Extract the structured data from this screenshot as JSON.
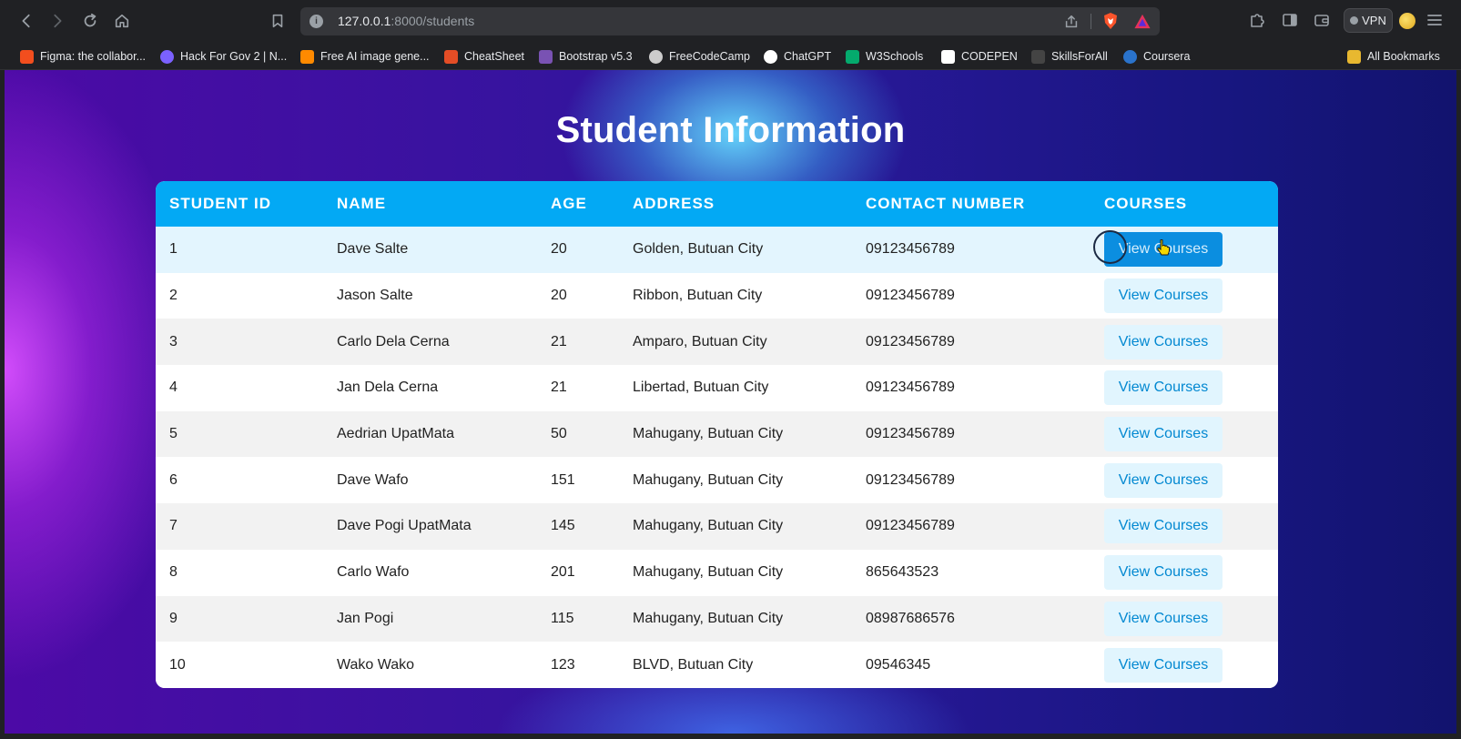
{
  "browser": {
    "url_host": "127.0.0.1",
    "url_rest": ":8000/students",
    "vpn_label": "VPN",
    "bookmarks": [
      {
        "label": "Figma: the collabor...",
        "icon": "figma-icon",
        "color": "#f24e1e"
      },
      {
        "label": "Hack For Gov 2 | N...",
        "icon": "hackforgov-icon",
        "color": "#7b61ff"
      },
      {
        "label": "Free AI image gene...",
        "icon": "pencil-icon",
        "color": "#ff8a00"
      },
      {
        "label": "CheatSheet",
        "icon": "html5-icon",
        "color": "#e44d26"
      },
      {
        "label": "Bootstrap v5.3",
        "icon": "bootstrap-icon",
        "color": "#7952b3"
      },
      {
        "label": "FreeCodeCamp",
        "icon": "freecodecamp-icon",
        "color": "#cccccc"
      },
      {
        "label": "ChatGPT",
        "icon": "chatgpt-icon",
        "color": "#ffffff"
      },
      {
        "label": "W3Schools",
        "icon": "w3schools-icon",
        "color": "#04aa6d"
      },
      {
        "label": "CODEPEN",
        "icon": "codepen-icon",
        "color": "#ffffff"
      },
      {
        "label": "SkillsForAll",
        "icon": "skillsforall-icon",
        "color": "#444444"
      },
      {
        "label": "Coursera",
        "icon": "coursera-icon",
        "color": "#2a73cc"
      }
    ],
    "all_bookmarks_label": "All Bookmarks"
  },
  "page": {
    "title": "Student Information",
    "columns": [
      "STUDENT ID",
      "NAME",
      "AGE",
      "ADDRESS",
      "CONTACT NUMBER",
      "COURSES"
    ],
    "button_label": "View Courses",
    "rows": [
      {
        "id": "1",
        "name": "Dave Salte",
        "age": "20",
        "address": "Golden, Butuan City",
        "contact": "09123456789"
      },
      {
        "id": "2",
        "name": "Jason Salte",
        "age": "20",
        "address": "Ribbon, Butuan City",
        "contact": "09123456789"
      },
      {
        "id": "3",
        "name": "Carlo Dela Cerna",
        "age": "21",
        "address": "Amparo, Butuan City",
        "contact": "09123456789"
      },
      {
        "id": "4",
        "name": "Jan Dela Cerna",
        "age": "21",
        "address": "Libertad, Butuan City",
        "contact": "09123456789"
      },
      {
        "id": "5",
        "name": "Aedrian UpatMata",
        "age": "50",
        "address": "Mahugany, Butuan City",
        "contact": "09123456789"
      },
      {
        "id": "6",
        "name": "Dave Wafo",
        "age": "151",
        "address": "Mahugany, Butuan City",
        "contact": "09123456789"
      },
      {
        "id": "7",
        "name": "Dave Pogi UpatMata",
        "age": "145",
        "address": "Mahugany, Butuan City",
        "contact": "09123456789"
      },
      {
        "id": "8",
        "name": "Carlo Wafo",
        "age": "201",
        "address": "Mahugany, Butuan City",
        "contact": "865643523"
      },
      {
        "id": "9",
        "name": "Jan Pogi",
        "age": "115",
        "address": "Mahugany, Butuan City",
        "contact": "08987686576"
      },
      {
        "id": "10",
        "name": "Wako Wako",
        "age": "123",
        "address": "BLVD, Butuan City",
        "contact": "09546345"
      }
    ]
  },
  "colors": {
    "header_bg": "#03a9f4",
    "button_bg": "#e1f5fe",
    "button_text": "#0288d1",
    "button_active_bg": "#0b8ee0"
  }
}
